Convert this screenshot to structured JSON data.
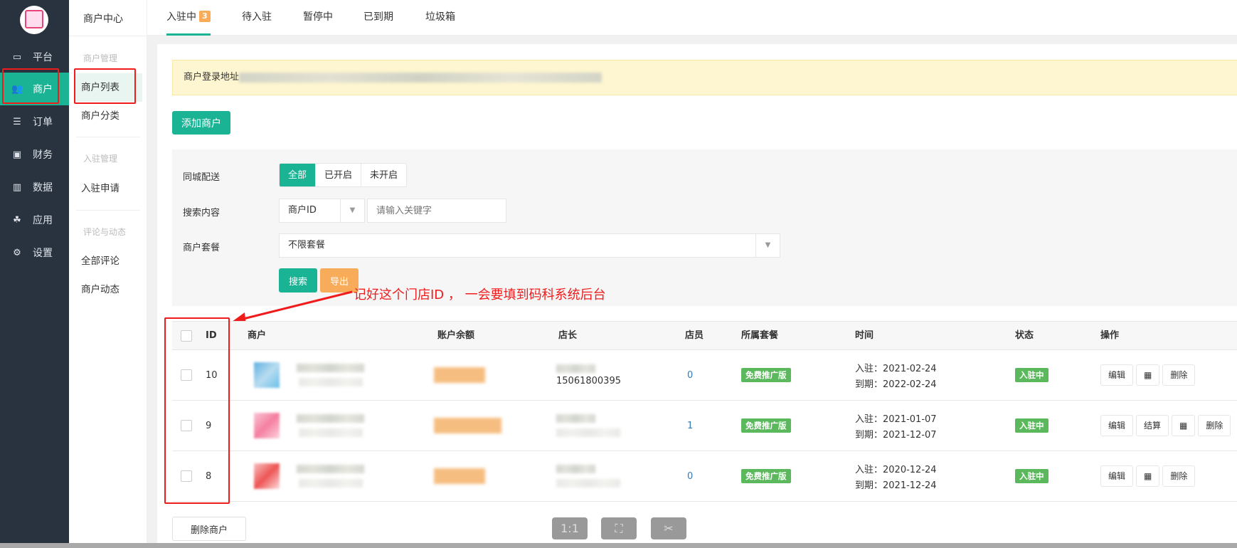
{
  "nav": {
    "items": [
      {
        "label": "平台",
        "icon": "monitor-icon"
      },
      {
        "label": "商户",
        "icon": "users-icon",
        "active": true
      },
      {
        "label": "订单",
        "icon": "list-icon"
      },
      {
        "label": "财务",
        "icon": "money-icon"
      },
      {
        "label": "数据",
        "icon": "bar-chart-icon"
      },
      {
        "label": "应用",
        "icon": "cubes-icon"
      },
      {
        "label": "设置",
        "icon": "gear-icon"
      }
    ]
  },
  "subnav": {
    "title": "商户中心",
    "groups": [
      {
        "label": "商户管理",
        "items": [
          "商户列表",
          "商户分类"
        ]
      },
      {
        "label": "入驻管理",
        "items": [
          "入驻申请"
        ]
      },
      {
        "label": "评论与动态",
        "items": [
          "全部评论",
          "商户动态"
        ]
      }
    ],
    "active": "商户列表"
  },
  "tabs": [
    {
      "label": "入驻中",
      "badge": "3",
      "active": true
    },
    {
      "label": "待入驻"
    },
    {
      "label": "暂停中"
    },
    {
      "label": "已到期"
    },
    {
      "label": "垃圾箱"
    }
  ],
  "notice": {
    "label": "商户登录地址"
  },
  "add_button": "添加商户",
  "filters": {
    "delivery": {
      "label": "同城配送",
      "options": [
        "全部",
        "已开启",
        "未开启"
      ],
      "selected": "全部"
    },
    "search": {
      "label": "搜索内容",
      "field": "商户ID",
      "placeholder": "请输入关键字",
      "value": ""
    },
    "package": {
      "label": "商户套餐",
      "value": "不限套餐"
    },
    "search_button": "搜索",
    "export_button": "导出"
  },
  "annotation": "记好这个门店ID ， 一会要填到码科系统后台",
  "table": {
    "headers": [
      "ID",
      "商户",
      "账户余额",
      "店长",
      "店员",
      "所属套餐",
      "时间",
      "状态",
      "操作"
    ],
    "rows": [
      {
        "id": "10",
        "owner_phone": "15061800395",
        "staff": "0",
        "package": "免费推广版",
        "join": "入驻：2021-02-24",
        "expire": "到期：2022-02-24",
        "status": "入驻中",
        "actions": [
          "编辑",
          "qr",
          "删除"
        ]
      },
      {
        "id": "9",
        "owner_phone": "",
        "staff": "1",
        "package": "免费推广版",
        "join": "入驻：2021-01-07",
        "expire": "到期：2021-12-07",
        "status": "入驻中",
        "actions": [
          "编辑",
          "结算",
          "qr",
          "删除"
        ]
      },
      {
        "id": "8",
        "owner_phone": "",
        "staff": "0",
        "package": "免费推广版",
        "join": "入驻：2020-12-24",
        "expire": "到期：2021-12-24",
        "status": "入驻中",
        "actions": [
          "编辑",
          "qr",
          "删除"
        ]
      }
    ]
  },
  "delete_button": "删除商户",
  "viewer": {
    "one_to_one": "1:1"
  },
  "colors": {
    "accent": "#1ab394",
    "warning": "#f8ac59",
    "success": "#5cb85c",
    "annotation": "#f01c1c",
    "nav_bg": "#293340"
  }
}
